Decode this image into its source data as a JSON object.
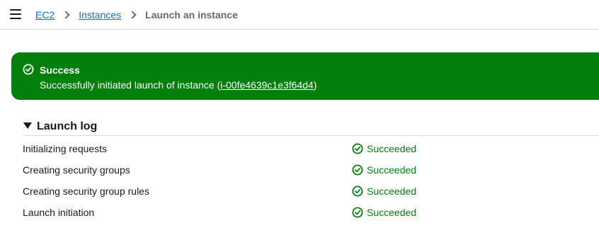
{
  "breadcrumb": {
    "items": [
      "EC2",
      "Instances"
    ],
    "current": "Launch an instance"
  },
  "flash": {
    "title": "Success",
    "message_prefix": "Successfully initiated launch of instance (",
    "instance_id": "i-00fe4639c1e3f64d4",
    "message_suffix": ")"
  },
  "launch_log": {
    "title": "Launch log",
    "rows": [
      {
        "label": "Initializing requests",
        "status": "Succeeded"
      },
      {
        "label": "Creating security groups",
        "status": "Succeeded"
      },
      {
        "label": "Creating security group rules",
        "status": "Succeeded"
      },
      {
        "label": "Launch initiation",
        "status": "Succeeded"
      }
    ]
  },
  "colors": {
    "success": "#037f0c",
    "link": "#0972d3"
  }
}
